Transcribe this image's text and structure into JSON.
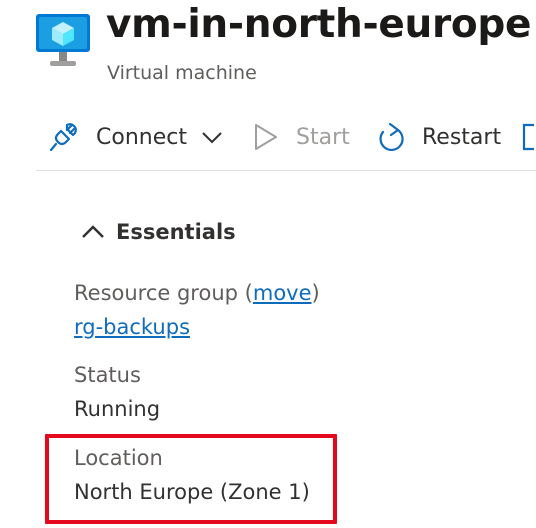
{
  "header": {
    "title": "vm-in-north-europe",
    "subtitle": "Virtual machine",
    "icon": "virtual-machine-icon"
  },
  "toolbar": {
    "connect_label": "Connect",
    "start_label": "Start",
    "restart_label": "Restart"
  },
  "essentials": {
    "header_label": "Essentials",
    "resource_group": {
      "label": "Resource group",
      "paren_open": " (",
      "move_link": "move",
      "paren_close": ")",
      "value": "rg-backups"
    },
    "status": {
      "label": "Status",
      "value": "Running"
    },
    "location": {
      "label": "Location",
      "value": "North Europe (Zone 1)"
    }
  },
  "colors": {
    "accent": "#0f6cbd",
    "highlight": "#e3081c"
  }
}
